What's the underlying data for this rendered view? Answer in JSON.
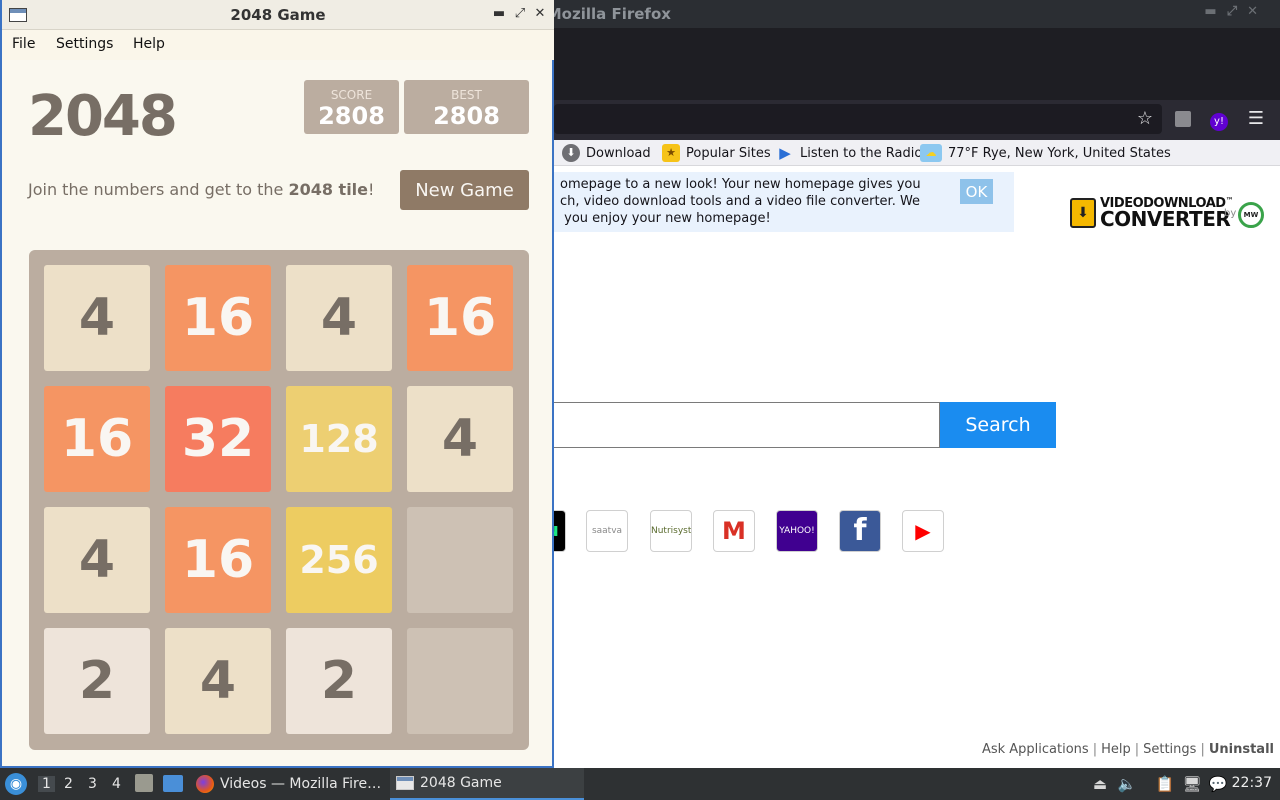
{
  "firefox": {
    "title": "Videos — Mozilla Firefox",
    "title_visible": "ideos — Mozilla Firefox",
    "bookmarks": [
      {
        "label": "Download"
      },
      {
        "label": "Popular Sites"
      },
      {
        "label": "Listen to the Radio"
      },
      {
        "label": "77°F Rye, New York, United States"
      }
    ],
    "notice": {
      "lines": [
        "omepage to a new look! Your new homepage gives you",
        "ch, video download tools and a video file converter. We",
        " you enjoy your new homepage!"
      ],
      "ok_label": "OK"
    },
    "logo": {
      "line1": "VIDEODOWNLOAD",
      "tm": "™",
      "line2": "CONVERTER",
      "by": "by",
      "mw": "MW"
    },
    "search": {
      "value": "",
      "button_label": "Search"
    },
    "quick_links": [
      {
        "name": "hulu",
        "label": "u",
        "color": "#000000",
        "text_color": "#1ce783"
      },
      {
        "name": "saatva",
        "label": "saatva",
        "color": "#ffffff",
        "text_color": "#8a8a8a"
      },
      {
        "name": "nutrisystem",
        "label": "Nutrisystem",
        "color": "#ffffff",
        "text_color": "#5a6b2e"
      },
      {
        "name": "gmail",
        "label": "M",
        "color": "#ffffff",
        "text_color": "#d93025"
      },
      {
        "name": "yahoo",
        "label": "YAHOO!",
        "color": "#400090",
        "text_color": "#ffffff"
      },
      {
        "name": "facebook",
        "label": "f",
        "color": "#3b5998",
        "text_color": "#ffffff"
      },
      {
        "name": "youtube",
        "label": "▶",
        "color": "#ffffff",
        "text_color": "#ff0000"
      }
    ],
    "footer": {
      "links": [
        "Ask Applications",
        "Help",
        "Settings"
      ],
      "uninstall": "Uninstall"
    }
  },
  "game_window": {
    "title": "2048 Game",
    "controls": {
      "minimize": "▬",
      "maximize": "⤢",
      "close": "✕"
    },
    "menu": [
      "File",
      "Settings",
      "Help"
    ],
    "heading": "2048",
    "score": {
      "label": "SCORE",
      "value": "2808"
    },
    "best": {
      "label": "BEST",
      "value": "2808"
    },
    "intro": {
      "before": "Join the numbers and get to the ",
      "bold": "2048 tile",
      "after": "!"
    },
    "new_game_label": "New Game",
    "board": [
      [
        4,
        16,
        4,
        16
      ],
      [
        16,
        32,
        128,
        4
      ],
      [
        4,
        16,
        256,
        null
      ],
      [
        2,
        4,
        2,
        null
      ]
    ],
    "tile_colors": {
      "2": {
        "bg": "#eee4da",
        "fg": "#776e65"
      },
      "4": {
        "bg": "#ede0c8",
        "fg": "#776e65"
      },
      "16": {
        "bg": "#f59563",
        "fg": "#f9f6f2"
      },
      "32": {
        "bg": "#f67c5f",
        "fg": "#f9f6f2"
      },
      "128": {
        "bg": "#edcf72",
        "fg": "#f9f6f2"
      },
      "256": {
        "bg": "#edcc61",
        "fg": "#f9f6f2"
      },
      "empty": {
        "bg": "#cdc1b4",
        "fg": "#cdc1b4"
      }
    }
  },
  "taskbar": {
    "workspaces": [
      "1",
      "2",
      "3",
      "4"
    ],
    "tasks": [
      {
        "label": "Videos — Mozilla Fire…"
      },
      {
        "label": "2048 Game"
      }
    ],
    "clock": "22:37"
  }
}
